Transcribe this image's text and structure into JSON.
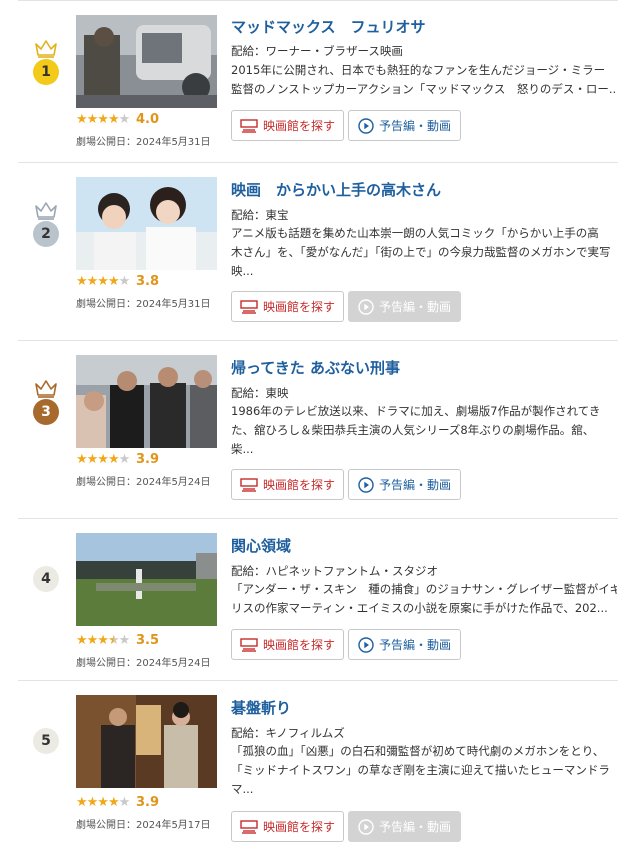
{
  "labels": {
    "release_prefix": "劇場公開日：",
    "distributor_prefix": "配給：",
    "find_theater": "映画館を探す",
    "trailer": "予告編・動画"
  },
  "colors": {
    "gold": "#f3c91a",
    "silver": "#b9c3cc",
    "bronze": "#a86a2c",
    "title_blue": "#1f5f9e",
    "theater_red": "#c72b2b",
    "star_orange": "#f0a81a"
  },
  "movies": [
    {
      "rank": "1",
      "title": "マッドマックス　フュリオサ",
      "distributor": "配給：ワーナー・ブラザース映画",
      "desc_lines": [
        "2015年に公開され、日本でも熱狂的なファンを生んだジョージ・ミラー",
        "監督のノンストップカーアクション「マッドマックス　怒りのデス・ロー..."
      ],
      "rating": 4.0,
      "score": "4.0",
      "release": "劇場公開日：2024年5月31日",
      "trailer_available": true
    },
    {
      "rank": "2",
      "title": "映画　からかい上手の高木さん",
      "distributor": "配給：東宝",
      "desc_lines": [
        "アニメ版も話題を集めた山本崇一朗の人気コミック「からかい上手の高",
        "木さん」を、「愛がなんだ」「街の上で」の今泉力哉監督のメガホンで実写",
        "映..."
      ],
      "rating": 3.8,
      "score": "3.8",
      "release": "劇場公開日：2024年5月31日",
      "trailer_available": false
    },
    {
      "rank": "3",
      "title": "帰ってきた あぶない刑事",
      "distributor": "配給：東映",
      "desc_lines": [
        "1986年のテレビ放送以来、ドラマに加え、劇場版7作品が製作されてき",
        "た、舘ひろし＆柴田恭兵主演の人気シリーズ8年ぶりの劇場作品。舘、",
        "柴..."
      ],
      "rating": 3.9,
      "score": "3.9",
      "release": "劇場公開日：2024年5月24日",
      "trailer_available": true
    },
    {
      "rank": "4",
      "title": "関心領域",
      "distributor": "配給：ハピネットファントム・スタジオ",
      "desc_lines": [
        "「アンダー・ザ・スキン　種の捕食」のジョナサン・グレイザー監督がイギ",
        "リスの作家マーティン・エイミスの小説を原案に手がけた作品で、202..."
      ],
      "rating": 3.5,
      "score": "3.5",
      "release": "劇場公開日：2024年5月24日",
      "trailer_available": true
    },
    {
      "rank": "5",
      "title": "碁盤斬り",
      "distributor": "配給：キノフィルムズ",
      "desc_lines": [
        "「孤狼の血」「凶悪」の白石和彌監督が初めて時代劇のメガホンをとり、",
        "「ミッドナイトスワン」の草なぎ剛を主演に迎えて描いたヒューマンドラ",
        "マ..."
      ],
      "rating": 3.9,
      "score": "3.9",
      "release": "劇場公開日：2024年5月17日",
      "trailer_available": false
    }
  ]
}
